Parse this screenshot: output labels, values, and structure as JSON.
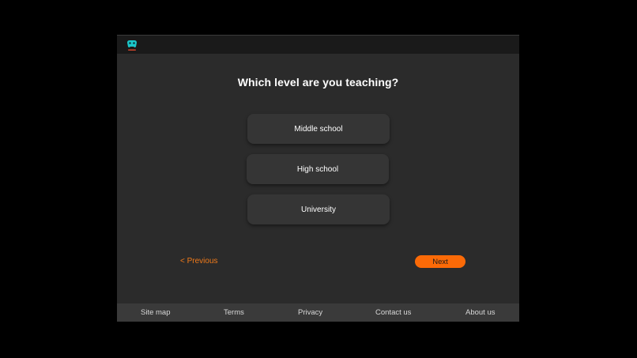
{
  "header": {
    "logo_icon": "game-controller-logo-icon",
    "logo_color": "#1bc7c9"
  },
  "question": {
    "title": "Which level are you teaching?"
  },
  "options": [
    {
      "label": "Middle school"
    },
    {
      "label": "High school"
    },
    {
      "label": "University"
    }
  ],
  "navigation": {
    "previous_label": "< Previous",
    "next_label": "Next",
    "accent_color": "#fb6a07"
  },
  "footer": {
    "links": [
      {
        "label": "Site map"
      },
      {
        "label": "Terms"
      },
      {
        "label": "Privacy"
      },
      {
        "label": "Contact us"
      },
      {
        "label": "About us"
      }
    ]
  }
}
